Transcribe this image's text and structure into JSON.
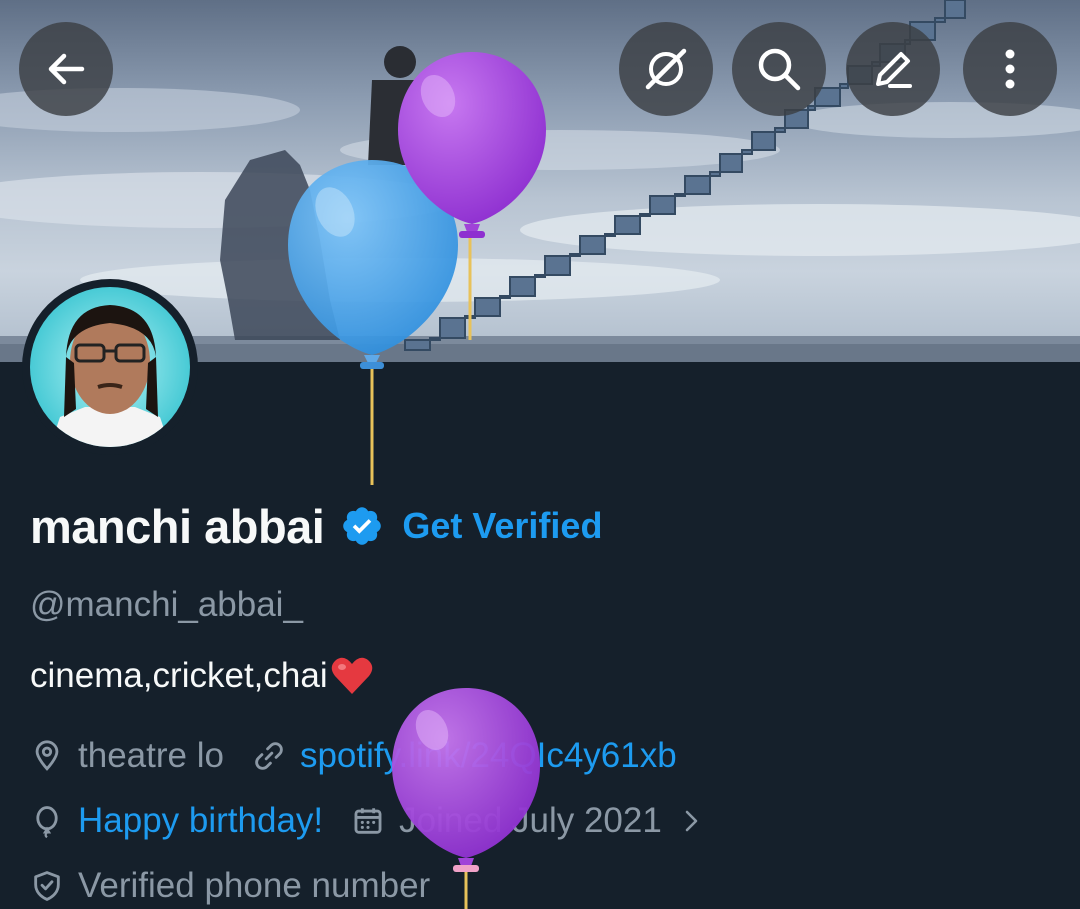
{
  "profile": {
    "display_name": "manchi abbai",
    "get_verified_label": "Get Verified",
    "handle": "@manchi_abbai_",
    "bio": "cinema,cricket,chai",
    "location": "theatre lo",
    "link": "spotify.link/24QIc4y61xb",
    "birthday": "Happy birthday!",
    "joined": "Joined July 2021",
    "verified_phone": "Verified phone number"
  },
  "top_bar": {
    "icons": [
      "back-arrow-icon",
      "grok-icon",
      "search-icon",
      "edit-icon",
      "more-vertical-icon"
    ]
  },
  "colors": {
    "background": "#15202b",
    "accent": "#1d9bf0",
    "muted": "#8b98a5",
    "balloon_purple": "#9b35d6",
    "balloon_blue": "#3aa0ee"
  }
}
